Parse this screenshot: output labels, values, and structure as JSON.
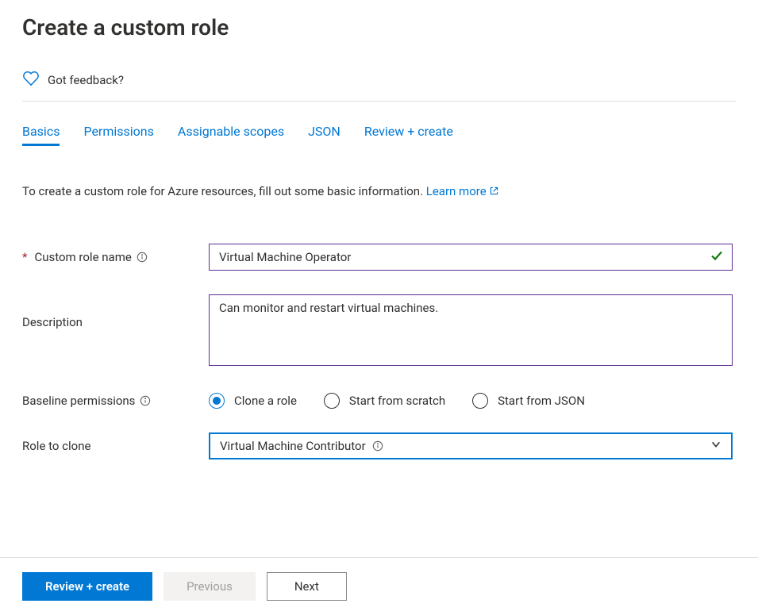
{
  "header": {
    "title": "Create a custom role",
    "feedback": "Got feedback?"
  },
  "tabs": [
    {
      "label": "Basics",
      "active": true
    },
    {
      "label": "Permissions",
      "active": false
    },
    {
      "label": "Assignable scopes",
      "active": false
    },
    {
      "label": "JSON",
      "active": false
    },
    {
      "label": "Review + create",
      "active": false
    }
  ],
  "intro": {
    "text": "To create a custom role for Azure resources, fill out some basic information. ",
    "link": "Learn more"
  },
  "form": {
    "roleName": {
      "label": "Custom role name",
      "value": "Virtual Machine Operator"
    },
    "description": {
      "label": "Description",
      "value": "Can monitor and restart virtual machines."
    },
    "baseline": {
      "label": "Baseline permissions",
      "options": [
        {
          "label": "Clone a role",
          "selected": true
        },
        {
          "label": "Start from scratch",
          "selected": false
        },
        {
          "label": "Start from JSON",
          "selected": false
        }
      ]
    },
    "roleToClone": {
      "label": "Role to clone",
      "value": "Virtual Machine Contributor"
    }
  },
  "footer": {
    "review": "Review + create",
    "previous": "Previous",
    "next": "Next"
  }
}
